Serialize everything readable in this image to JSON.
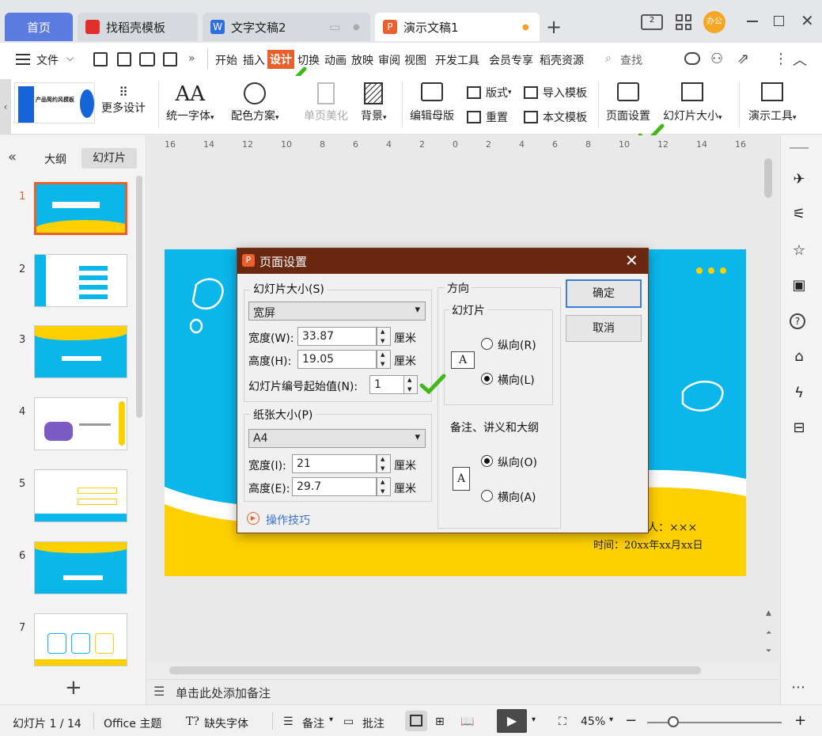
{
  "tabs": {
    "home": "首页",
    "t1": "找稻壳模板",
    "t2": "文字文稿2",
    "t3": "演示文稿1",
    "add": "+",
    "avatar": "办公"
  },
  "menu": {
    "file": "文件",
    "more": "»",
    "items": [
      "开始",
      "插入",
      "设计",
      "切换",
      "动画",
      "放映",
      "审阅",
      "视图",
      "开发工具",
      "会员专享",
      "稻壳资源"
    ],
    "search": "查找"
  },
  "ribbon": {
    "more_design": "更多设计",
    "unify_font": "统一字体",
    "color_scheme": "配色方案",
    "beautify": "单页美化",
    "background": "背景",
    "edit_master": "编辑母版",
    "layout": "版式",
    "reset": "重置",
    "import_template": "导入模板",
    "this_template": "本文模板",
    "page_setup": "页面设置",
    "slide_size": "幻灯片大小",
    "present_tools": "演示工具",
    "template_preview_title": "产品简约风模板"
  },
  "ruler": {
    "labels": [
      "16",
      "14",
      "12",
      "10",
      "8",
      "6",
      "4",
      "2",
      "0",
      "2",
      "4",
      "6",
      "8",
      "10",
      "12",
      "14",
      "16"
    ]
  },
  "left": {
    "collapse": "«",
    "tab_outline": "大纲",
    "tab_slides": "幻灯片",
    "nums": [
      "1",
      "2",
      "3",
      "4",
      "5",
      "6",
      "7"
    ],
    "add": "+"
  },
  "slide": {
    "presenter": "人：×××",
    "time": "时间：20xx年xx月xx日"
  },
  "notes": "单击此处添加备注",
  "dialog": {
    "title": "页面设置",
    "slide_size_group": "幻灯片大小(S)",
    "slide_size_value": "宽屏",
    "width_label": "宽度(W):",
    "width_value": "33.87",
    "height_label": "高度(H):",
    "height_value": "19.05",
    "unit": "厘米",
    "start_num_label": "幻灯片编号起始值(N):",
    "start_num_value": "1",
    "paper_group": "纸张大小(P)",
    "paper_value": "A4",
    "paper_width_label": "宽度(I):",
    "paper_width_value": "21",
    "paper_height_label": "高度(E):",
    "paper_height_value": "29.7",
    "tips": "操作技巧",
    "orientation": "方向",
    "slides_group": "幻灯片",
    "portrait": "纵向(R)",
    "landscape": "横向(L)",
    "notes_group": "备注、讲义和大纲",
    "notes_portrait": "纵向(O)",
    "notes_landscape": "横向(A)",
    "ok": "确定",
    "cancel": "取消",
    "page_icon_letter": "A"
  },
  "status": {
    "slide_count": "幻灯片 1 / 14",
    "theme": "Office 主题",
    "missing_font": "缺失字体",
    "notes": "备注",
    "comment": "批注",
    "zoom": "45%"
  },
  "colors": {
    "accent_orange": "#e8612c",
    "dialog_title": "#6b2810",
    "slide_blue": "#0bb6ea",
    "slide_yellow": "#ffd000",
    "check_green": "#43b81d"
  }
}
